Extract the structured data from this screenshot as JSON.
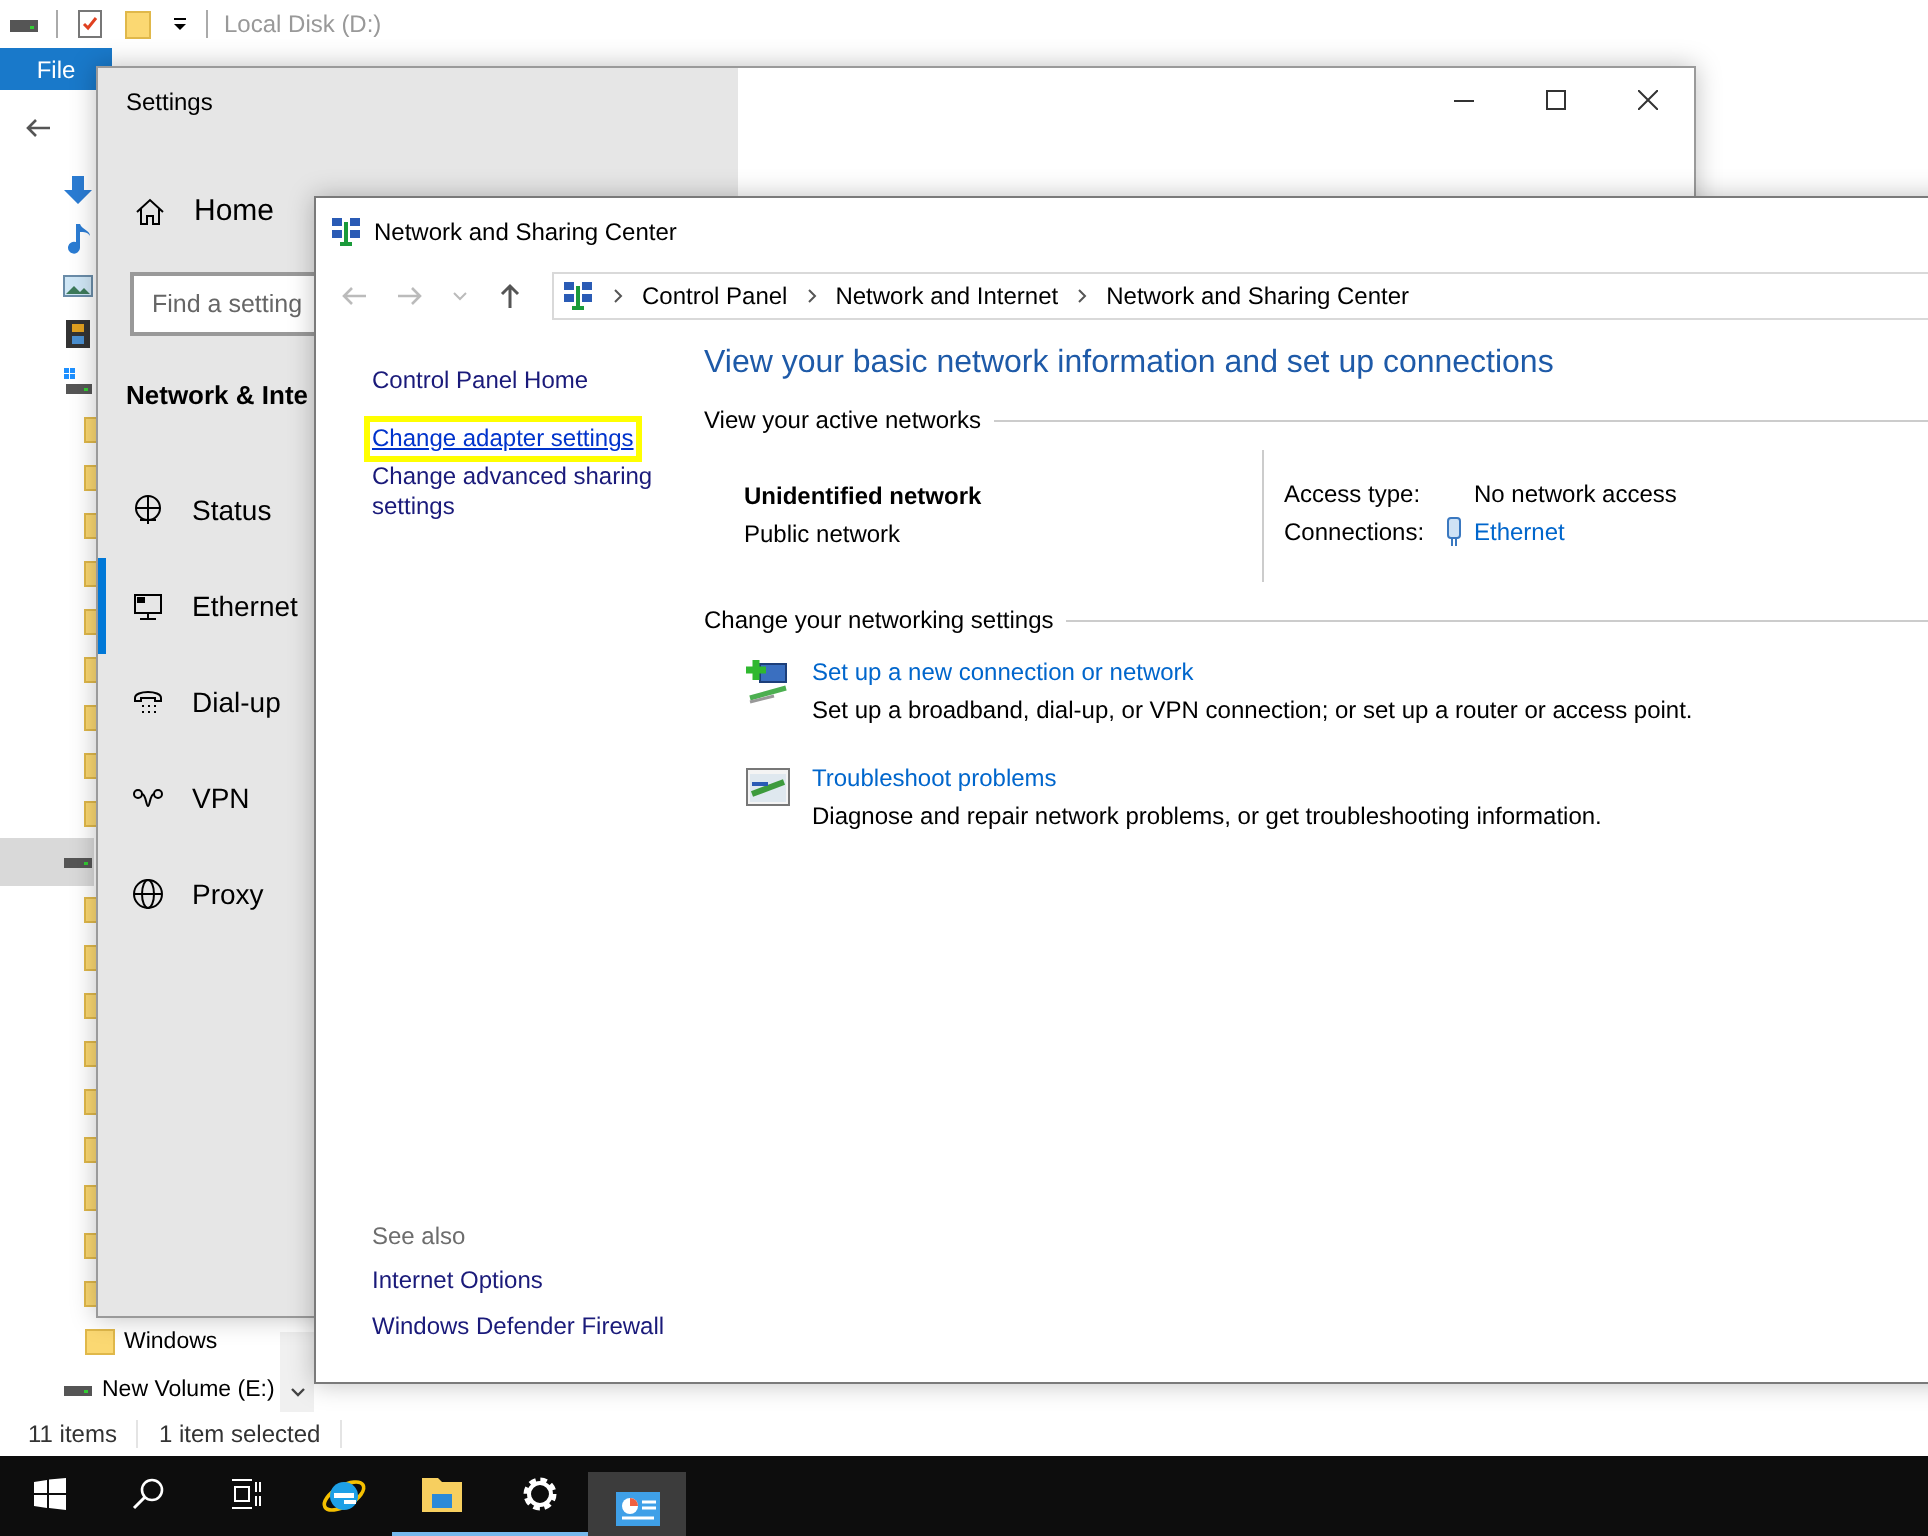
{
  "explorer": {
    "title": "Local Disk (D:)",
    "ribbon_tab": "File",
    "tree": [
      {
        "kind": "downloads",
        "selected": false
      },
      {
        "kind": "music",
        "selected": false
      },
      {
        "kind": "pictures",
        "selected": false
      },
      {
        "kind": "videos",
        "selected": false
      },
      {
        "kind": "system-drive",
        "selected": false
      },
      {
        "kind": "folder",
        "selected": false
      },
      {
        "kind": "folder",
        "selected": false
      },
      {
        "kind": "folder",
        "selected": false
      },
      {
        "kind": "folder",
        "selected": false
      },
      {
        "kind": "folder",
        "selected": false
      },
      {
        "kind": "folder",
        "selected": false
      },
      {
        "kind": "folder",
        "selected": false
      },
      {
        "kind": "folder",
        "selected": false
      },
      {
        "kind": "folder",
        "selected": false
      },
      {
        "kind": "drive",
        "selected": true
      },
      {
        "kind": "folder",
        "selected": false
      },
      {
        "kind": "folder",
        "selected": false
      },
      {
        "kind": "folder",
        "selected": false
      },
      {
        "kind": "folder",
        "selected": false
      },
      {
        "kind": "folder",
        "selected": false
      },
      {
        "kind": "folder",
        "selected": false
      },
      {
        "kind": "folder",
        "selected": false
      },
      {
        "kind": "folder",
        "selected": false
      },
      {
        "kind": "folder",
        "selected": false
      },
      {
        "kind": "folder",
        "label": "Windows",
        "selected": false
      },
      {
        "kind": "drive",
        "label": "New Volume (E:)",
        "selected": false
      }
    ],
    "status_bar": [
      "11 items",
      "1 item selected"
    ]
  },
  "settings": {
    "title": "Settings",
    "home": "Home",
    "search": {
      "placeholder": "Find a setting"
    },
    "section": "Network & Inte",
    "nav": [
      {
        "kind": "status",
        "label": "Status",
        "selected": false
      },
      {
        "kind": "ethernet",
        "label": "Ethernet",
        "selected": true
      },
      {
        "kind": "dialup",
        "label": "Dial-up",
        "selected": false
      },
      {
        "kind": "vpn",
        "label": "VPN",
        "selected": false
      },
      {
        "kind": "proxy",
        "label": "Proxy",
        "selected": false
      }
    ]
  },
  "nsc": {
    "title": "Network and Sharing Center",
    "breadcrumb": [
      "Control Panel",
      "Network and Internet",
      "Network and Sharing Center"
    ],
    "sidebar_links": [
      {
        "label": "Control Panel Home",
        "highlighted": false
      },
      {
        "label": "Change adapter settings",
        "highlighted": true
      },
      {
        "label": "Change advanced sharing settings",
        "highlighted": false
      }
    ],
    "see_also": {
      "heading": "See also",
      "links": [
        "Internet Options",
        "Windows Defender Firewall"
      ]
    },
    "heading": "View your basic network information and set up connections",
    "active_networks": {
      "title": "View your active networks",
      "name": "Unidentified network",
      "type": "Public network",
      "details": [
        {
          "kind": "text",
          "label": "Access type:",
          "value": "No network access"
        },
        {
          "kind": "link",
          "label": "Connections:",
          "value": "Ethernet"
        }
      ]
    },
    "networking_settings": {
      "title": "Change your networking settings",
      "tasks": [
        {
          "kind": "setup",
          "title": "Set up a new connection or network",
          "description": "Set up a broadband, dial-up, or VPN connection; or set up a router or access point."
        },
        {
          "kind": "troubleshoot",
          "title": "Troubleshoot problems",
          "description": "Diagnose and repair network problems, or get troubleshooting information."
        }
      ]
    }
  },
  "taskbar": [
    {
      "kind": "start",
      "running": false,
      "active": false
    },
    {
      "kind": "search",
      "running": false,
      "active": false
    },
    {
      "kind": "taskview",
      "running": false,
      "active": false
    },
    {
      "kind": "ie",
      "running": false,
      "active": false
    },
    {
      "kind": "explorer",
      "running": true,
      "active": false
    },
    {
      "kind": "settings",
      "running": true,
      "active": false
    },
    {
      "kind": "network",
      "running": true,
      "active": true
    }
  ]
}
